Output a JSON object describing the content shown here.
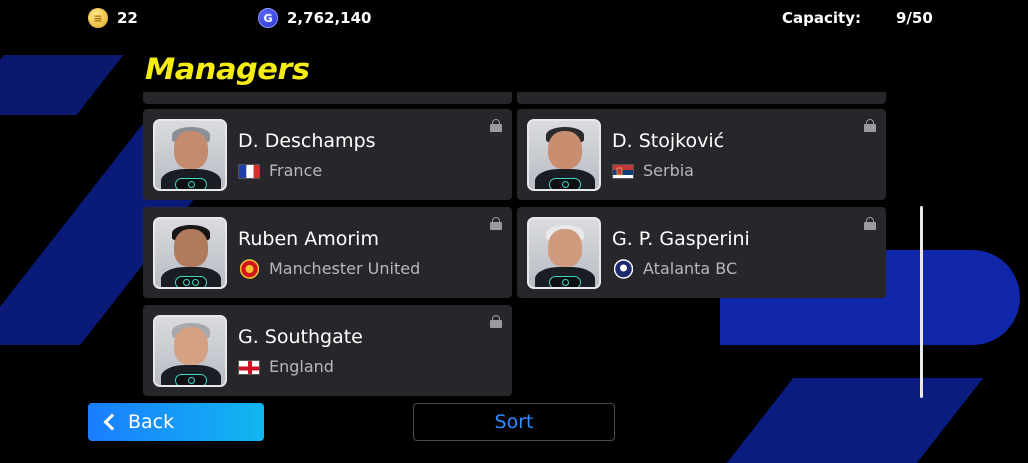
{
  "topbar": {
    "coins_icon": "gold-coin-icon",
    "coins": "22",
    "gp_icon": "gp-coin-icon",
    "gp": "2,762,140",
    "capacity_label": "Capacity:",
    "capacity_value": "9/50"
  },
  "page": {
    "title": "Managers"
  },
  "managers": [
    {
      "name": "D. Deschamps",
      "team": "France",
      "badge_count": 1,
      "icon": "flag-france-icon",
      "locked": true
    },
    {
      "name": "D. Stojković",
      "team": "Serbia",
      "badge_count": 1,
      "icon": "flag-serbia-icon",
      "locked": true
    },
    {
      "name": "Ruben Amorim",
      "team": "Manchester United",
      "badge_count": 2,
      "icon": "manchester-united-crest-icon",
      "locked": true
    },
    {
      "name": "G. P. Gasperini",
      "team": "Atalanta BC",
      "badge_count": 1,
      "icon": "atalanta-crest-icon",
      "locked": true
    },
    {
      "name": "G. Southgate",
      "team": "England",
      "badge_count": 1,
      "icon": "flag-england-icon",
      "locked": true
    }
  ],
  "footer": {
    "back_label": "Back",
    "sort_label": "Sort"
  },
  "colors": {
    "title": "#f5ec12",
    "card": "#26262b",
    "accent_blue": "#1a7dff",
    "sort_text": "#2f8cff",
    "badge": "#3fd6c6"
  }
}
